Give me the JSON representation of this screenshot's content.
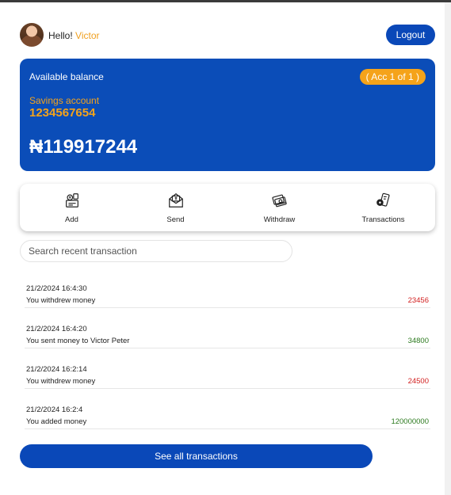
{
  "header": {
    "greeting": "Hello!",
    "user_name": "Victor",
    "logout_label": "Logout"
  },
  "balance_card": {
    "label": "Available balance",
    "account_badge": "( Acc 1 of 1 )",
    "account_type": "Savings account",
    "account_number": "1234567654",
    "balance": "₦119917244",
    "bg_color": "#0b4db8",
    "accent_color": "#f5a31a"
  },
  "actions": [
    {
      "label": "Add",
      "icon": "add-money-icon"
    },
    {
      "label": "Send",
      "icon": "send-envelope-icon"
    },
    {
      "label": "Withdraw",
      "icon": "withdraw-cash-icon"
    },
    {
      "label": "Transactions",
      "icon": "transactions-icon"
    }
  ],
  "search": {
    "placeholder": "Search recent transaction",
    "value": ""
  },
  "transactions": [
    {
      "date": "21/2/2024 16:4:30",
      "description": "You withdrew money",
      "amount": "23456",
      "type": "debit"
    },
    {
      "date": "21/2/2024 16:4:20",
      "description": "You sent money to Victor Peter",
      "amount": "34800",
      "type": "credit"
    },
    {
      "date": "21/2/2024 16:2:14",
      "description": "You withdrew money",
      "amount": "24500",
      "type": "debit"
    },
    {
      "date": "21/2/2024 16:2:4",
      "description": "You added money",
      "amount": "120000000",
      "type": "credit"
    }
  ],
  "see_all_label": "See all transactions",
  "colors": {
    "primary": "#0a48b8",
    "debit": "#d21f1f",
    "credit": "#2c7a1f"
  }
}
